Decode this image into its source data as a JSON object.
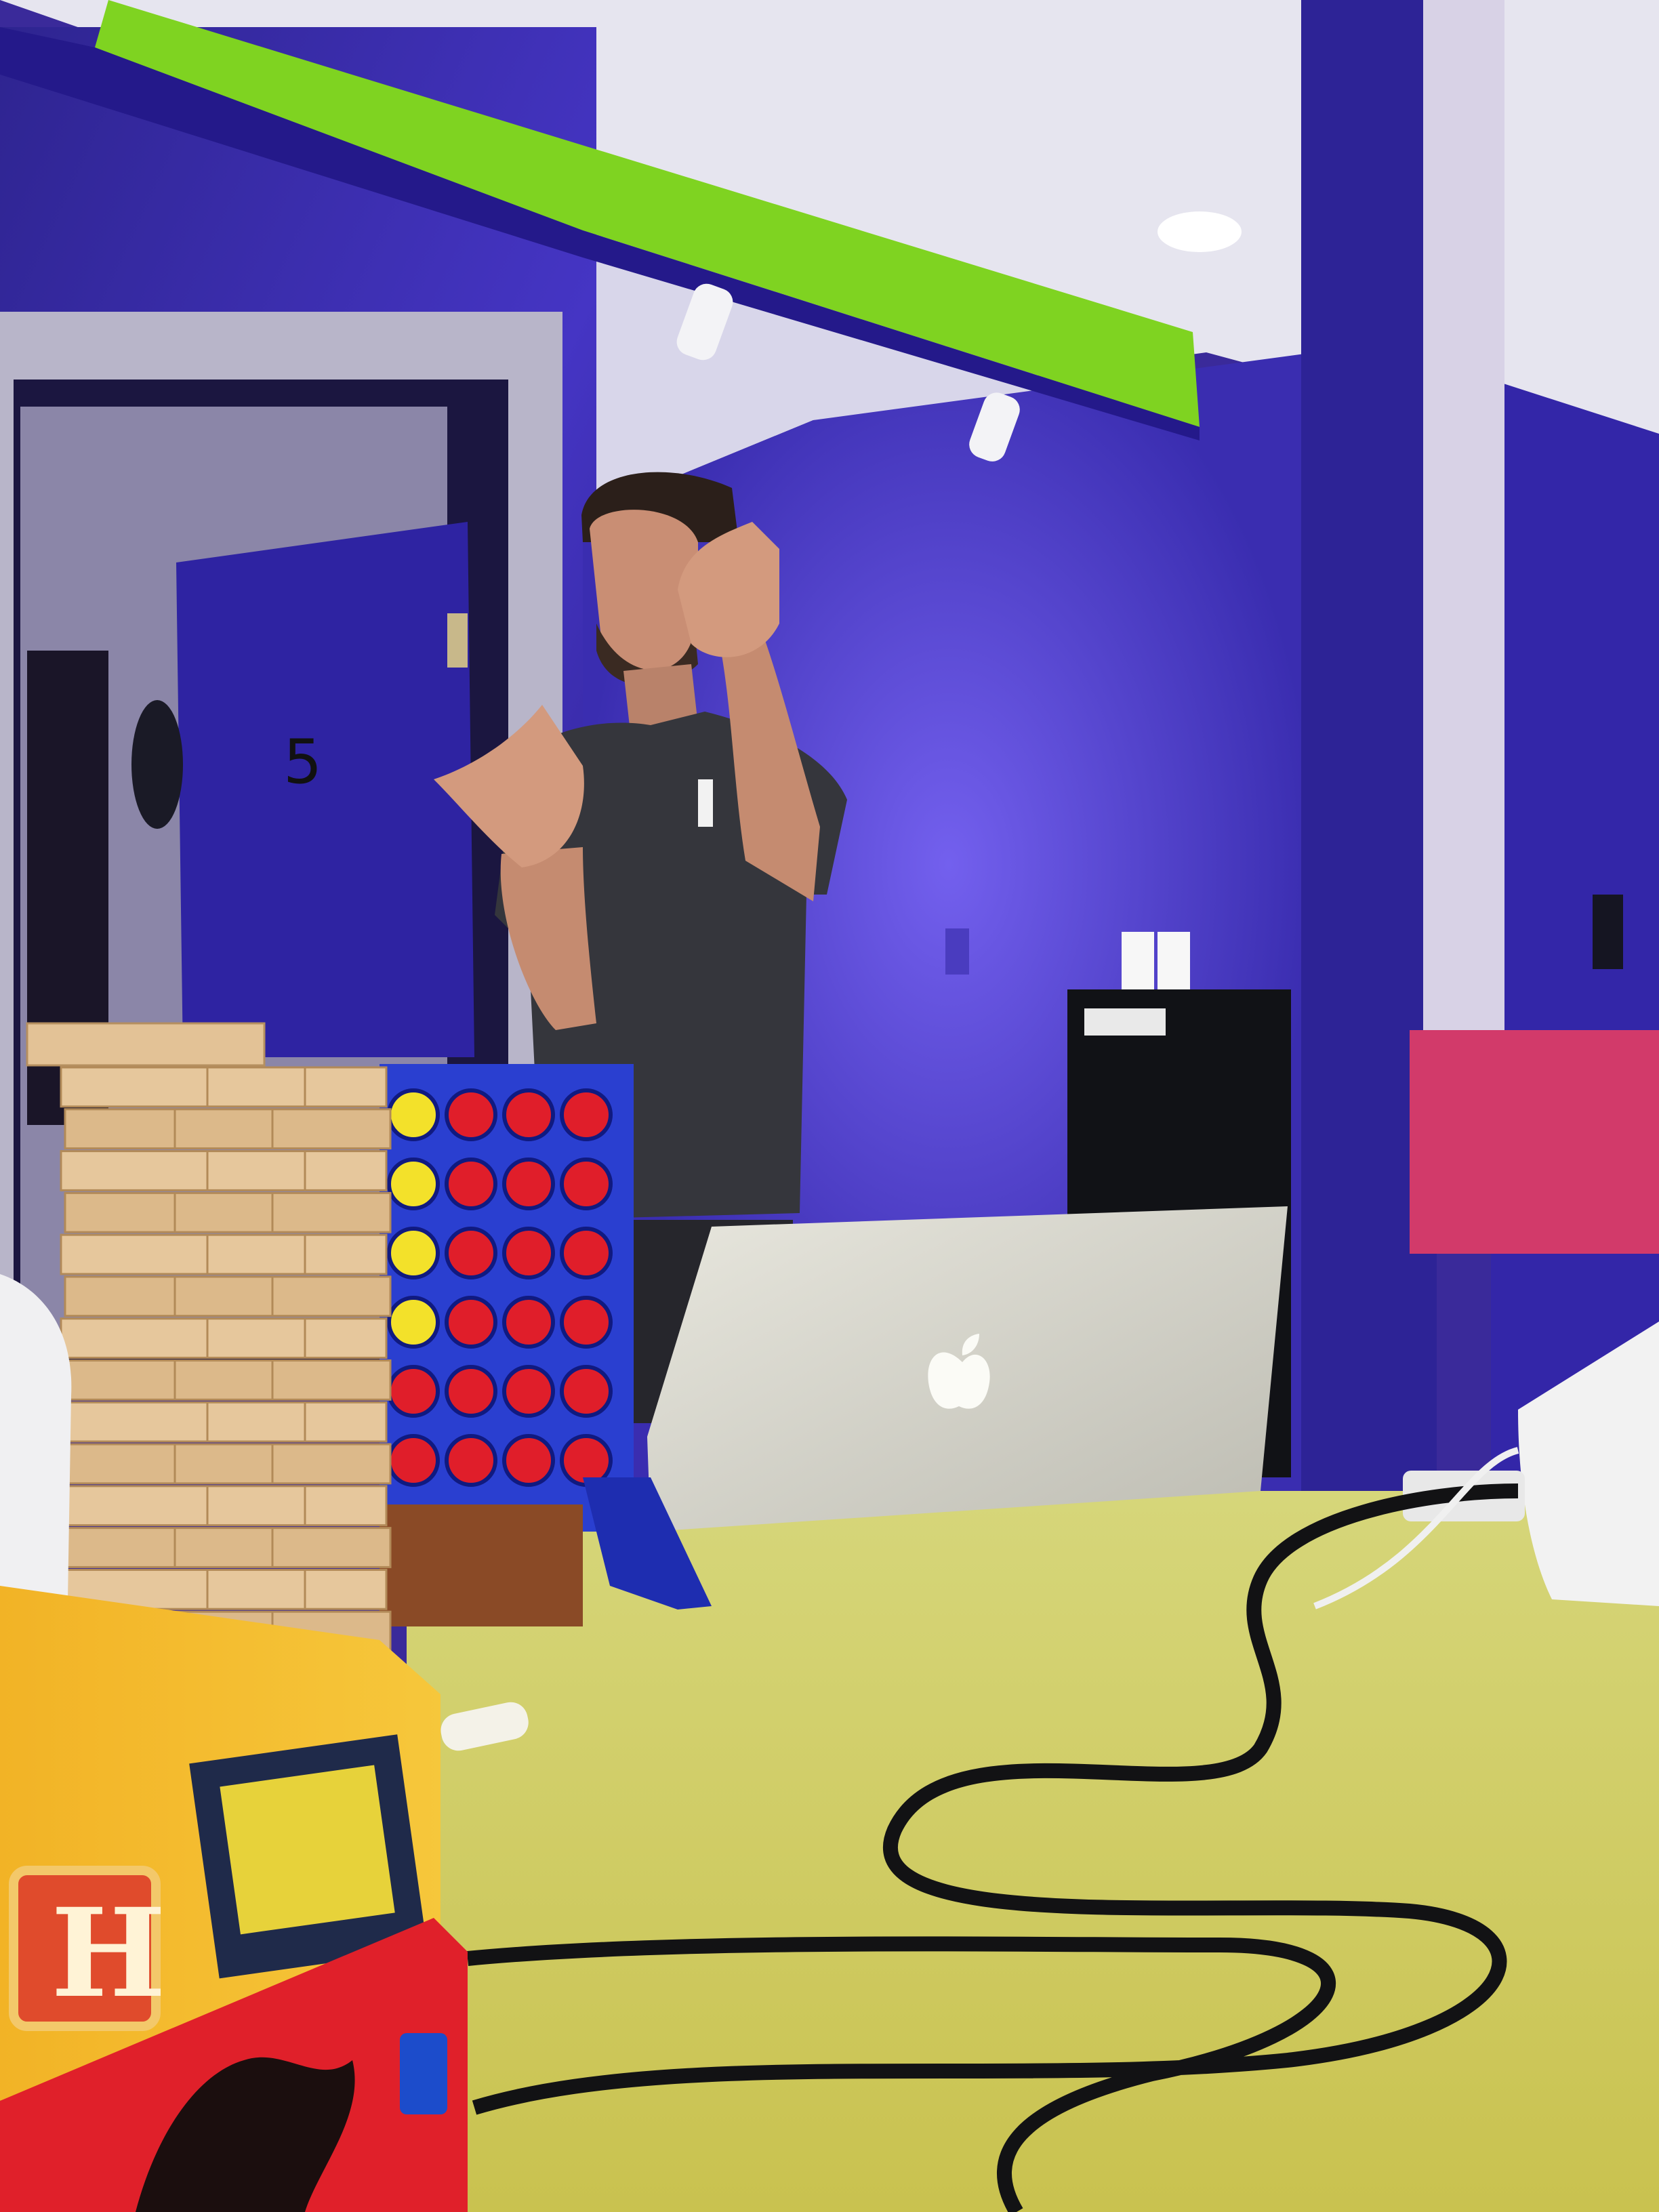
{
  "scene": {
    "door_number": "5",
    "connect_four": {
      "columns": 4,
      "rows": 6,
      "discs": [
        [
          "yellow",
          "red",
          "red",
          "red"
        ],
        [
          "yellow",
          "red",
          "red",
          "red"
        ],
        [
          "yellow",
          "red",
          "red",
          "red"
        ],
        [
          "yellow",
          "red",
          "red",
          "red"
        ],
        [
          "red",
          "red",
          "red",
          "red"
        ],
        [
          "red",
          "red",
          "red",
          "red"
        ]
      ],
      "colors": {
        "board": "#2a3fd0",
        "red": "#e01e2a",
        "yellow": "#f3e12a"
      }
    },
    "jenga": {
      "layers": 14
    },
    "game_box_letter": "H",
    "colors": {
      "wall": "#3b2fb0",
      "ceiling": "#e9e8f2",
      "beam_green": "#7fd321",
      "table": "#d8d66a",
      "laptop": "#d9d8cf",
      "pink_panel": "#d23a6a"
    }
  }
}
